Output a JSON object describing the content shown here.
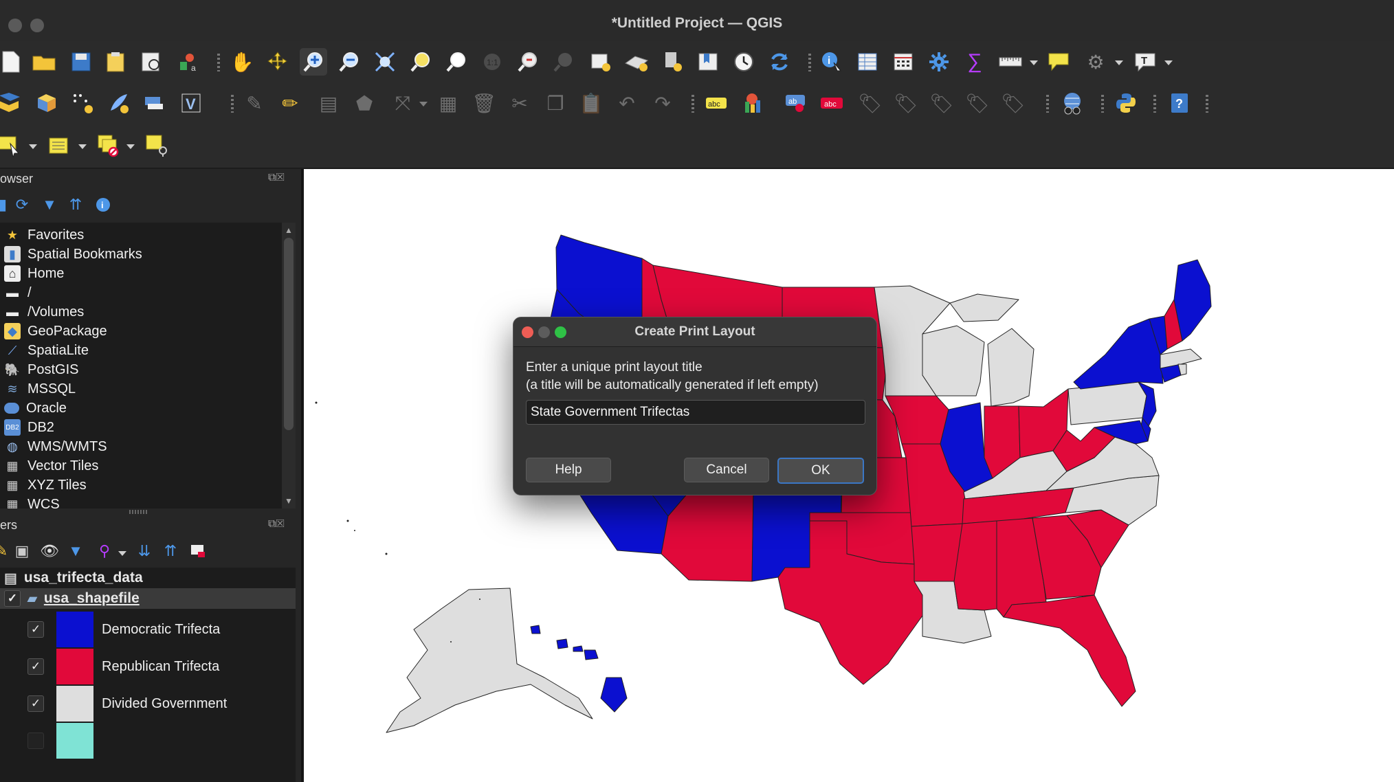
{
  "window": {
    "title": "*Untitled Project — QGIS"
  },
  "browser_panel": {
    "title": "owser",
    "items": [
      {
        "label": "Favorites",
        "icon": "star-icon"
      },
      {
        "label": "Spatial Bookmarks",
        "icon": "bookmark-icon"
      },
      {
        "label": "Home",
        "icon": "home-icon"
      },
      {
        "label": "/",
        "icon": "folder-icon"
      },
      {
        "label": "/Volumes",
        "icon": "folder-icon"
      },
      {
        "label": "GeoPackage",
        "icon": "geopackage-icon"
      },
      {
        "label": "SpatiaLite",
        "icon": "feather-icon"
      },
      {
        "label": "PostGIS",
        "icon": "elephant-icon"
      },
      {
        "label": "MSSQL",
        "icon": "mssql-icon"
      },
      {
        "label": "Oracle",
        "icon": "oracle-icon"
      },
      {
        "label": "DB2",
        "icon": "db2-icon"
      },
      {
        "label": "WMS/WMTS",
        "icon": "globe-icon"
      },
      {
        "label": "Vector Tiles",
        "icon": "grid-icon"
      },
      {
        "label": "XYZ Tiles",
        "icon": "grid-icon"
      },
      {
        "label": "WCS",
        "icon": "grid-icon"
      }
    ]
  },
  "layers_panel": {
    "title": "ers",
    "layers": [
      {
        "name": "usa_trifecta_data",
        "icon": "table-icon"
      },
      {
        "name": "usa_shapefile",
        "icon": "polygon-layer-icon",
        "checked": "✓"
      }
    ],
    "legend": [
      {
        "label": "Democratic Trifecta",
        "color": "#0b10d0",
        "check": "✓"
      },
      {
        "label": "Republican Trifecta",
        "color": "#e1093a",
        "check": "✓"
      },
      {
        "label": "Divided Government",
        "color": "#dedede",
        "check": "✓"
      },
      {
        "label": "",
        "color": "#7fe3d5",
        "check": ""
      }
    ]
  },
  "dialog": {
    "title": "Create Print Layout",
    "prompt_line1": "Enter a unique print layout title",
    "prompt_line2": "(a title will be automatically generated if left empty)",
    "input_value": "State Government Trifectas",
    "help_label": "Help",
    "cancel_label": "Cancel",
    "ok_label": "OK"
  },
  "colors": {
    "democratic": "#0b10d0",
    "republican": "#e1093a",
    "divided": "#dedede",
    "other": "#7fe3d5"
  }
}
